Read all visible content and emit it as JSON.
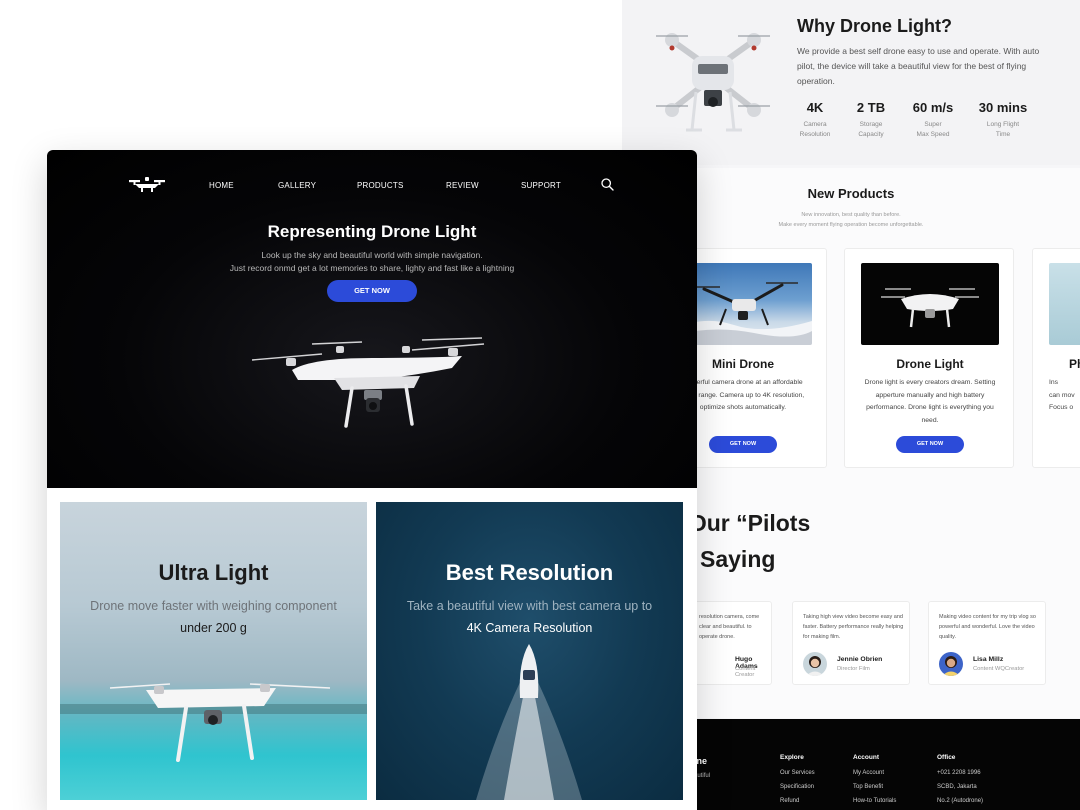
{
  "why": {
    "title": "Why Drone Light?",
    "text": "We provide a best self drone easy to use and operate. With auto pilot, the device will take a beautiful view for the best of flying operation.",
    "stats": [
      {
        "value": "4K",
        "label": "Camera\nResolution"
      },
      {
        "value": "2 TB",
        "label": "Storage\nCapacity"
      },
      {
        "value": "60 m/s",
        "label": "Super\nMax Speed"
      },
      {
        "value": "30 mins",
        "label": "Long Flight\nTime"
      }
    ]
  },
  "new_products": {
    "title": "New Products",
    "subtitle": "New innovation, best quality than before.\nMake every moment flying operation become unforgettable.",
    "products": [
      {
        "name": "Mini Drone",
        "desc": "Powerful camera drone at an affordable price range. Camera up to 4K resolution, optimize shots automatically.",
        "button": "GET NOW"
      },
      {
        "name": "Drone Light",
        "desc": "Drone light is every creators dream. Setting apperture manually and high battery  performance. Drone light is everything you need.",
        "button": "GET NOW"
      },
      {
        "name": "Ph",
        "desc": "Ins\ncan mov\nFocus o",
        "button": ""
      }
    ]
  },
  "testimonials": {
    "heading_line1": "at Our “Pilots",
    "heading_line2": "Saying",
    "items": [
      {
        "quote": "resolution camera, come clear and beautiful. to operate drone.",
        "name": "Hugo Adams",
        "role": "Content Creator"
      },
      {
        "quote": "Taking high view video become easy and faster. Battery performance really helping for making film.",
        "name": "Jennie Obrien",
        "role": "Director Film"
      },
      {
        "quote": "Making video content for my trip vlog so powerful and wonderful. Love the video quality.",
        "name": "Lisa Millz",
        "role": "Content WQCreator"
      }
    ]
  },
  "footer": {
    "brand": "utodrone",
    "tagline": "ky and beautiful",
    "columns": [
      {
        "heading": "Explore",
        "items": [
          "Our Services",
          "Specification",
          "Refund"
        ]
      },
      {
        "heading": "Account",
        "items": [
          "My Account",
          "Top Benefit",
          "How-to Tutorials"
        ]
      },
      {
        "heading": "Office",
        "items": [
          "+021 2208 1996",
          "SCBD, Jakarta",
          "No.2 (Autodrone)"
        ]
      }
    ]
  },
  "nav": {
    "items": [
      "HOME",
      "GALLERY",
      "PRODUCTS",
      "REVIEW",
      "SUPPORT"
    ]
  },
  "hero": {
    "title": "Representing Drone Light",
    "subtitle": "Look up the  sky and beautiful world with simple navigation.\nJust record onmd get a lot memories to share, lighty and fast like a lightning",
    "button": "GET NOW"
  },
  "features": [
    {
      "title": "Ultra Light",
      "desc_plain": "Drone move faster with weighing component ",
      "desc_strong": "under 200 g"
    },
    {
      "title": "Best Resolution",
      "desc_plain": "Take a beautiful view with best camera up to ",
      "desc_strong": "4K Camera Resolution"
    }
  ],
  "colors": {
    "accent": "#2c4bd9",
    "hero_bg": "#000000",
    "footer_bg": "#050505"
  },
  "icons": {
    "search": "search-icon",
    "logo": "drone-logo-icon"
  }
}
